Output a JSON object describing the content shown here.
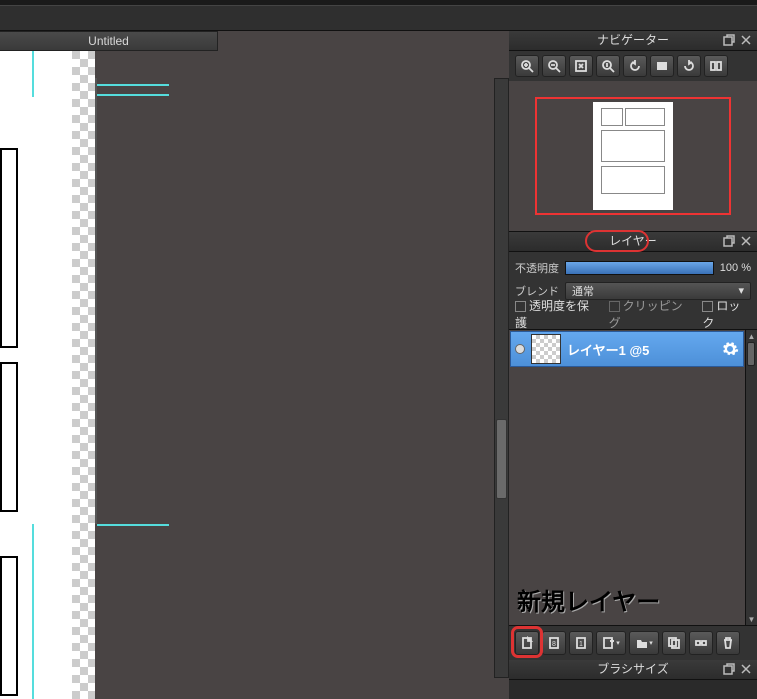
{
  "document": {
    "tab_title": "Untitled"
  },
  "navigator": {
    "title": "ナビゲーター",
    "tools": [
      "zoom-in",
      "zoom-plus",
      "fit",
      "zoom-minus",
      "rotate-ccw",
      "flip-h",
      "rotate-cw",
      "reset-view"
    ]
  },
  "layers": {
    "title": "レイヤー",
    "opacity_label": "不透明度",
    "opacity_value": 100,
    "opacity_suffix": "%",
    "blend_label": "ブレンド",
    "blend_value": "通常",
    "preserve_alpha_label": "透明度を保護",
    "clipping_label": "クリッピング",
    "lock_label": "ロック",
    "items": [
      {
        "name": "レイヤー1 @5",
        "visible": true
      }
    ],
    "toolbar": [
      "new-layer",
      "new-raster",
      "new-vector",
      "add-special",
      "new-folder",
      "duplicate",
      "merge",
      "delete"
    ]
  },
  "annotation": {
    "new_layer_text": "新規レイヤー"
  },
  "brush": {
    "title": "ブラシサイズ"
  }
}
